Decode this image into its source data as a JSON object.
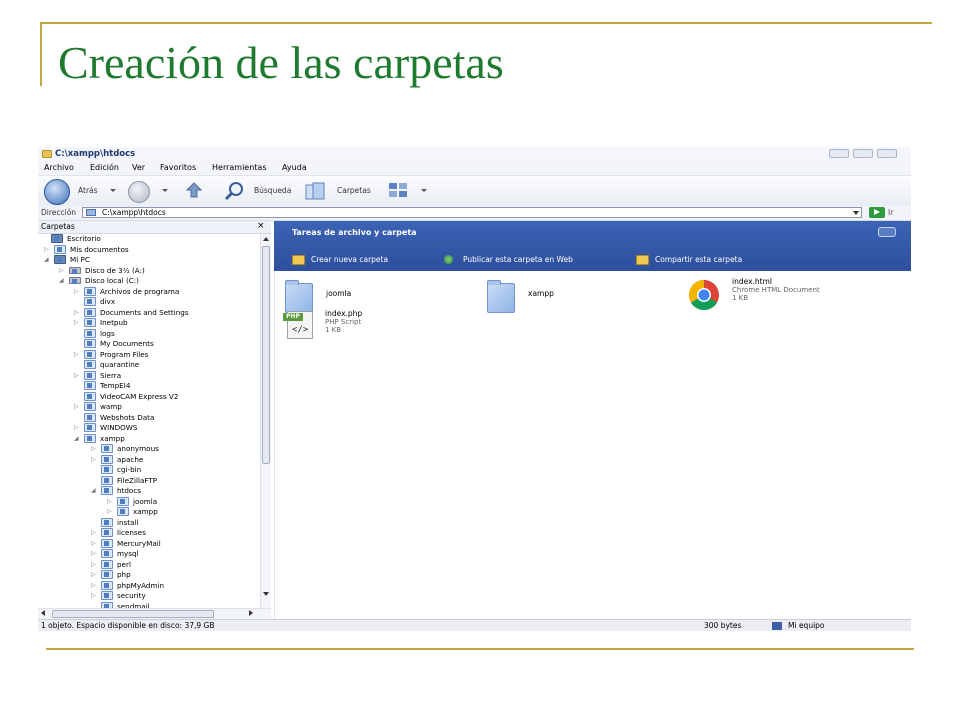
{
  "slide": {
    "title": "Creación de las carpetas"
  },
  "window": {
    "title": "C:\\xampp\\htdocs",
    "menu": [
      "Archivo",
      "Edición",
      "Ver",
      "Favoritos",
      "Herramientas",
      "Ayuda"
    ],
    "toolbar": {
      "back": "Atrás",
      "search": "Búsqueda",
      "folders": "Carpetas"
    },
    "address": {
      "label": "Dirección",
      "value": "C:\\xampp\\htdocs",
      "go": "Ir"
    },
    "tree_header": {
      "label": "Carpetas",
      "close": "×"
    },
    "tree": [
      {
        "label": "Escritorio",
        "level": 0,
        "expander": "",
        "icon": "desktop-icon"
      },
      {
        "label": "Mis documentos",
        "level": 1,
        "expander": "▷",
        "icon": "folder-icon"
      },
      {
        "label": "Mi PC",
        "level": 1,
        "expander": "◢",
        "icon": "computer-icon"
      },
      {
        "label": "Disco de 3½ (A:)",
        "level": 2,
        "expander": "▷",
        "icon": "floppy-icon"
      },
      {
        "label": "Disco local (C:)",
        "level": 2,
        "expander": "◢",
        "icon": "drive-icon"
      },
      {
        "label": "Archivos de programa",
        "level": 3,
        "expander": "▷",
        "icon": "folder-icon"
      },
      {
        "label": "divx",
        "level": 3,
        "expander": "",
        "icon": "folder-icon"
      },
      {
        "label": "Documents and Settings",
        "level": 3,
        "expander": "▷",
        "icon": "folder-icon"
      },
      {
        "label": "Inetpub",
        "level": 3,
        "expander": "▷",
        "icon": "folder-icon"
      },
      {
        "label": "logs",
        "level": 3,
        "expander": "",
        "icon": "folder-icon"
      },
      {
        "label": "My Documents",
        "level": 3,
        "expander": "",
        "icon": "folder-icon"
      },
      {
        "label": "Program Files",
        "level": 3,
        "expander": "▷",
        "icon": "folder-icon"
      },
      {
        "label": "quarantine",
        "level": 3,
        "expander": "",
        "icon": "folder-icon"
      },
      {
        "label": "Sierra",
        "level": 3,
        "expander": "▷",
        "icon": "folder-icon"
      },
      {
        "label": "TempEI4",
        "level": 3,
        "expander": "",
        "icon": "folder-icon"
      },
      {
        "label": "VideoCAM Express V2",
        "level": 3,
        "expander": "",
        "icon": "folder-icon"
      },
      {
        "label": "wamp",
        "level": 3,
        "expander": "▷",
        "icon": "folder-icon"
      },
      {
        "label": "Webshots Data",
        "level": 3,
        "expander": "",
        "icon": "folder-icon"
      },
      {
        "label": "WINDOWS",
        "level": 3,
        "expander": "▷",
        "icon": "folder-icon"
      },
      {
        "label": "xampp",
        "level": 3,
        "expander": "◢",
        "icon": "folder-icon"
      },
      {
        "label": "anonymous",
        "level": 4,
        "expander": "▷",
        "icon": "folder-icon"
      },
      {
        "label": "apache",
        "level": 4,
        "expander": "▷",
        "icon": "folder-icon"
      },
      {
        "label": "cgi-bin",
        "level": 4,
        "expander": "",
        "icon": "folder-icon"
      },
      {
        "label": "FileZillaFTP",
        "level": 4,
        "expander": "",
        "icon": "folder-icon"
      },
      {
        "label": "htdocs",
        "level": 4,
        "expander": "◢",
        "icon": "folder-icon"
      },
      {
        "label": "joomla",
        "level": 5,
        "expander": "▷",
        "icon": "folder-icon"
      },
      {
        "label": "xampp",
        "level": 5,
        "expander": "▷",
        "icon": "folder-icon"
      },
      {
        "label": "install",
        "level": 4,
        "expander": "",
        "icon": "folder-icon"
      },
      {
        "label": "licenses",
        "level": 4,
        "expander": "▷",
        "icon": "folder-icon"
      },
      {
        "label": "MercuryMail",
        "level": 4,
        "expander": "▷",
        "icon": "folder-icon"
      },
      {
        "label": "mysql",
        "level": 4,
        "expander": "▷",
        "icon": "folder-icon"
      },
      {
        "label": "perl",
        "level": 4,
        "expander": "▷",
        "icon": "folder-icon"
      },
      {
        "label": "php",
        "level": 4,
        "expander": "▷",
        "icon": "folder-icon"
      },
      {
        "label": "phpMyAdmin",
        "level": 4,
        "expander": "▷",
        "icon": "folder-icon"
      },
      {
        "label": "security",
        "level": 4,
        "expander": "▷",
        "icon": "folder-icon"
      },
      {
        "label": "sendmail",
        "level": 4,
        "expander": "",
        "icon": "folder-icon"
      }
    ],
    "tasks": {
      "title": "Tareas de archivo y carpeta",
      "items": [
        "Crear nueva carpeta",
        "Publicar esta carpeta en Web",
        "Compartir esta carpeta"
      ]
    },
    "files": [
      {
        "name": "joomla",
        "type": "",
        "size": "",
        "icon": "folder-icon"
      },
      {
        "name": "xampp",
        "type": "",
        "size": "",
        "icon": "folder-icon"
      },
      {
        "name": "index.html",
        "type": "Chrome HTML Document",
        "size": "1 KB",
        "icon": "chrome-icon"
      },
      {
        "name": "index.php",
        "type": "PHP Script",
        "size": "1 KB",
        "icon": "php-icon",
        "badge": "PHP",
        "glyph": "</>"
      }
    ],
    "status": {
      "left": "1 objeto. Espacio disponible en disco: 37,9 GB",
      "size": "300 bytes",
      "location": "Mi equipo"
    }
  }
}
